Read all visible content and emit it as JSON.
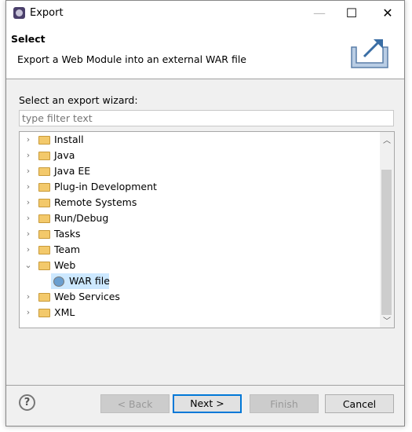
{
  "window": {
    "title": "Export",
    "minimize": "—",
    "maximize": "☐",
    "close": "✕"
  },
  "header": {
    "title": "Select",
    "description": "Export a Web Module into an external WAR file"
  },
  "wizard_label": "Select an export wizard:",
  "filter": {
    "placeholder": "type filter text",
    "value": ""
  },
  "tree": [
    {
      "label": "Install",
      "type": "folder",
      "expanded": false
    },
    {
      "label": "Java",
      "type": "folder",
      "expanded": false
    },
    {
      "label": "Java EE",
      "type": "folder",
      "expanded": false
    },
    {
      "label": "Plug-in Development",
      "type": "folder",
      "expanded": false
    },
    {
      "label": "Remote Systems",
      "type": "folder",
      "expanded": false
    },
    {
      "label": "Run/Debug",
      "type": "folder",
      "expanded": false
    },
    {
      "label": "Tasks",
      "type": "folder",
      "expanded": false
    },
    {
      "label": "Team",
      "type": "folder",
      "expanded": false
    },
    {
      "label": "Web",
      "type": "folder",
      "expanded": true
    },
    {
      "label": "WAR file",
      "type": "item",
      "selected": true
    },
    {
      "label": "Web Services",
      "type": "folder",
      "expanded": false
    },
    {
      "label": "XML",
      "type": "folder",
      "expanded": false
    }
  ],
  "buttons": {
    "help": "?",
    "back": "< Back",
    "next": "Next >",
    "finish": "Finish",
    "cancel": "Cancel"
  },
  "colors": {
    "accent": "#0078d7",
    "selection": "#cce8ff"
  }
}
